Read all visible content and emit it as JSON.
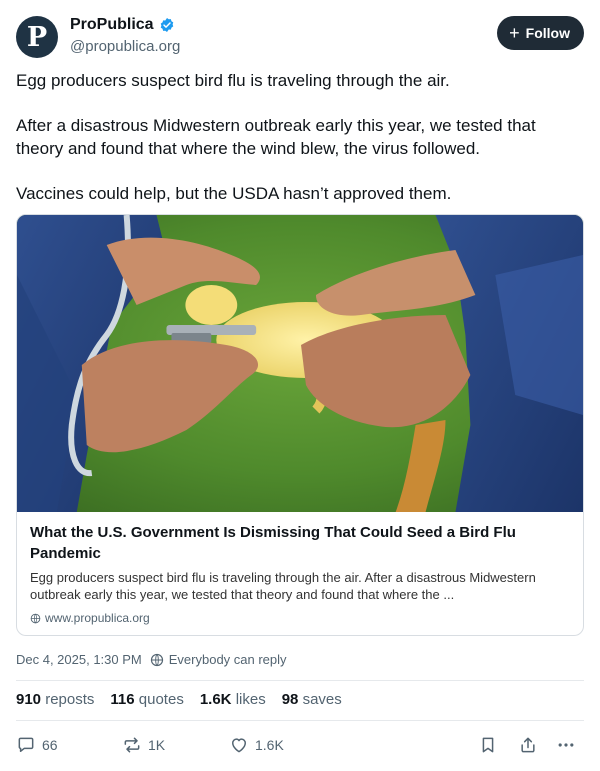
{
  "account": {
    "avatar_letter": "P",
    "name": "ProPublica",
    "handle": "@propublica.org",
    "follow_label": "Follow"
  },
  "post": {
    "paragraphs": [
      "Egg producers suspect bird flu is traveling through the air.",
      "After a disastrous Midwestern outbreak early this year, we tested that theory and found that where the wind blew, the virus followed.",
      "Vaccines could help, but the USDA hasn’t approved them."
    ]
  },
  "link_card": {
    "title": "What the U.S. Government Is Dismissing That Could Seed a Bird Flu Pandemic",
    "description": "Egg producers suspect bird flu is traveling through the air. After a disastrous Midwestern outbreak early this year, we tested that theory and found that where the ...",
    "domain": "www.propublica.org"
  },
  "meta": {
    "timestamp": "Dec 4, 2025, 1:30 PM",
    "reply_setting": "Everybody can reply"
  },
  "stats": {
    "reposts_count": "910",
    "reposts_label": "reposts",
    "quotes_count": "116",
    "quotes_label": "quotes",
    "likes_count": "1.6K",
    "likes_label": "likes",
    "saves_count": "98",
    "saves_label": "saves"
  },
  "actions": {
    "reply_count": "66",
    "repost_count": "1K",
    "like_count": "1.6K"
  },
  "icons": [
    "verified-badge-icon",
    "plus-icon",
    "globe-icon",
    "reply-icon",
    "repost-icon",
    "heart-icon",
    "bookmark-icon",
    "share-icon",
    "more-icon"
  ],
  "colors": {
    "accent_verified": "#1d9bf0",
    "follow_button_bg": "#1f2b36",
    "muted_text": "#536471"
  }
}
